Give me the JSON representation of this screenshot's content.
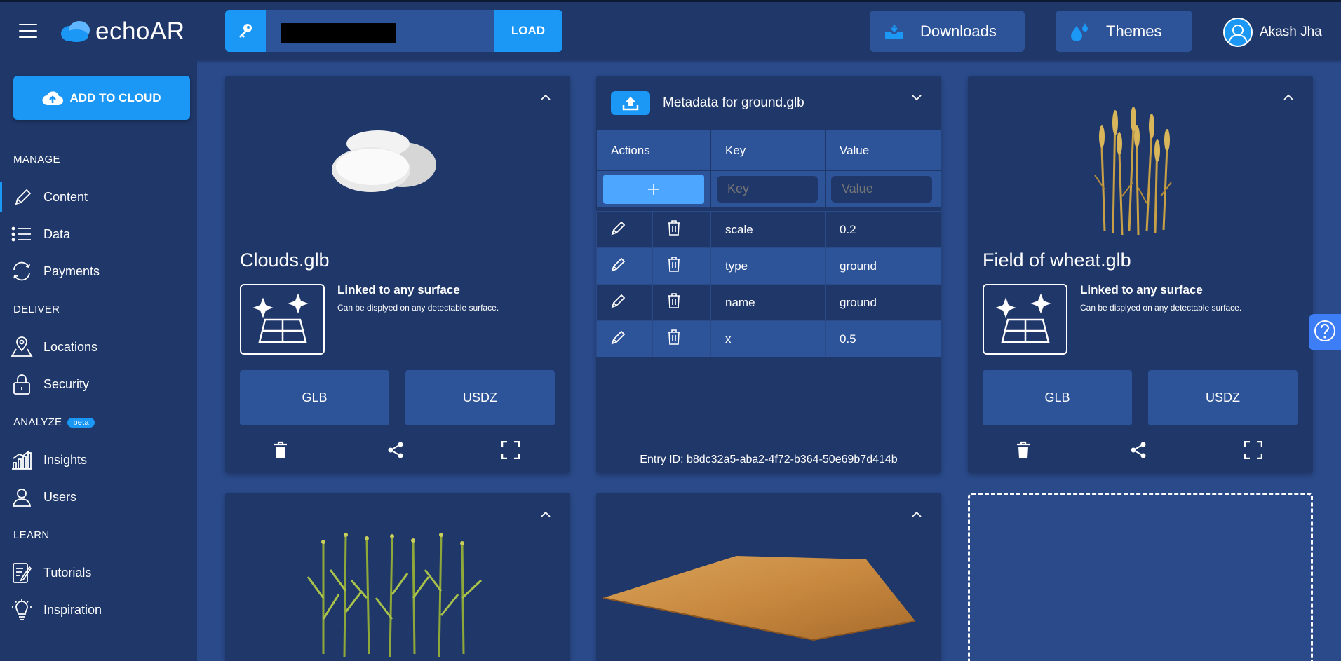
{
  "app": {
    "logo_text": "echoAR",
    "accent_color": "#1b97f5"
  },
  "topbar": {
    "load_label": "LOAD",
    "downloads_label": "Downloads",
    "themes_label": "Themes",
    "user_name": "Akash Jha"
  },
  "sidebar": {
    "add_to_cloud_label": "ADD TO CLOUD",
    "sections": {
      "manage": "MANAGE",
      "deliver": "DELIVER",
      "analyze": "ANALYZE",
      "analyze_badge": "beta",
      "learn": "LEARN"
    },
    "items": {
      "content": "Content",
      "data": "Data",
      "payments": "Payments",
      "locations": "Locations",
      "security": "Security",
      "insights": "Insights",
      "users": "Users",
      "tutorials": "Tutorials",
      "inspiration": "Inspiration"
    }
  },
  "cards": {
    "clouds": {
      "title": "Clouds.glb",
      "surface_title": "Linked to any surface",
      "surface_desc": "Can be displyed on any detectable surface.",
      "glb_label": "GLB",
      "usdz_label": "USDZ"
    },
    "wheat": {
      "title": "Field of wheat.glb",
      "surface_title": "Linked to any surface",
      "surface_desc": "Can be displyed on any detectable surface.",
      "glb_label": "GLB",
      "usdz_label": "USDZ"
    }
  },
  "metadata": {
    "title": "Metadata for ground.glb",
    "headers": {
      "actions": "Actions",
      "key": "Key",
      "value": "Value"
    },
    "key_placeholder": "Key",
    "value_placeholder": "Value",
    "rows": [
      {
        "key": "scale",
        "value": "0.2"
      },
      {
        "key": "type",
        "value": "ground"
      },
      {
        "key": "name",
        "value": "ground"
      },
      {
        "key": "x",
        "value": "0.5"
      }
    ],
    "entry_id": "Entry ID: b8dc32a5-aba2-4f72-b364-50e69b7d414b"
  }
}
